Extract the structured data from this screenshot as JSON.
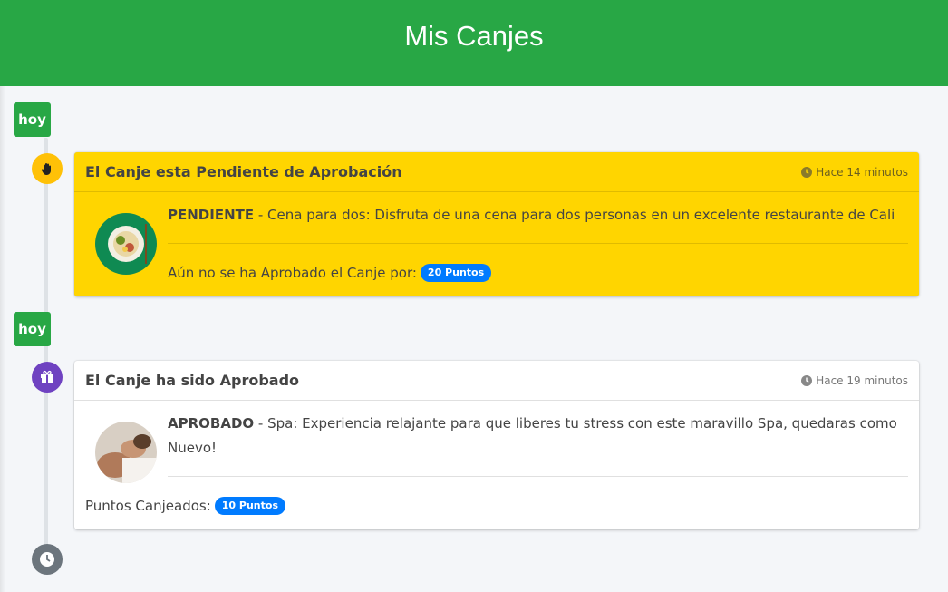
{
  "header": {
    "title": "Mis Canjes"
  },
  "timeline": [
    {
      "label": "hoy",
      "icon": "hand-icon",
      "card": {
        "title": "El Canje esta Pendiente de Aprobación",
        "time": "Hace 14 minutos",
        "status": "PENDIENTE",
        "description": " - Cena para dos: Disfruta de una cena para dos personas en un excelente restaurante de Cali",
        "footer_text": "Aún no se ha Aprobado el Canje por:",
        "badge": "20 Puntos",
        "background": "#ffd500"
      }
    },
    {
      "label": "hoy",
      "icon": "gift-icon",
      "card": {
        "title": "El Canje ha sido Aprobado",
        "time": "Hace 19 minutos",
        "status": "APROBADO",
        "description": " - Spa: Experiencia relajante para que liberes tu stress con este maravillo Spa, quedaras como Nuevo!",
        "footer_text": "Puntos Canjeados:",
        "badge": "10 Puntos",
        "background": "#ffffff"
      }
    }
  ],
  "end_icon": "clock-icon",
  "colors": {
    "header": "#28a745",
    "badge": "#007bff",
    "warning": "#ffc107",
    "purple": "#6f42c1"
  }
}
